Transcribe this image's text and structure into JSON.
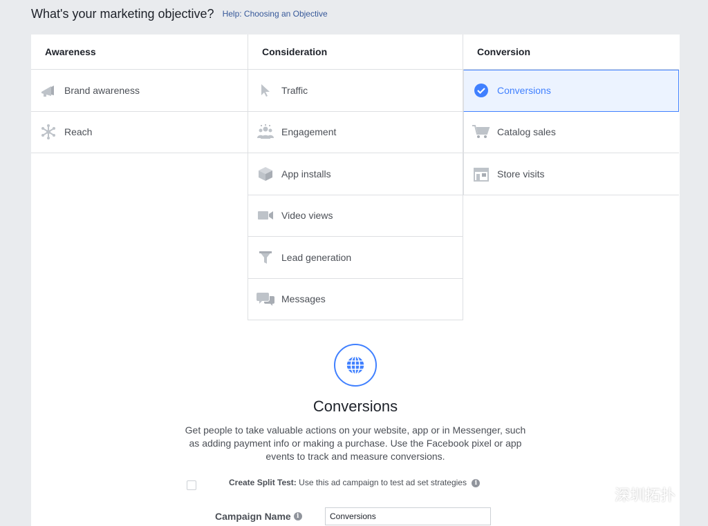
{
  "header": {
    "title": "What's your marketing objective?",
    "help_link": "Help: Choosing an Objective"
  },
  "columns": {
    "awareness": {
      "title": "Awareness",
      "items": [
        {
          "label": "Brand awareness",
          "icon": "megaphone-icon"
        },
        {
          "label": "Reach",
          "icon": "reach-icon"
        }
      ]
    },
    "consideration": {
      "title": "Consideration",
      "items": [
        {
          "label": "Traffic",
          "icon": "cursor-icon"
        },
        {
          "label": "Engagement",
          "icon": "people-icon"
        },
        {
          "label": "App installs",
          "icon": "box-icon"
        },
        {
          "label": "Video views",
          "icon": "video-camera-icon"
        },
        {
          "label": "Lead generation",
          "icon": "funnel-icon"
        },
        {
          "label": "Messages",
          "icon": "chat-bubbles-icon"
        }
      ]
    },
    "conversion": {
      "title": "Conversion",
      "items": [
        {
          "label": "Conversions",
          "icon": "check-circle-icon",
          "selected": true
        },
        {
          "label": "Catalog sales",
          "icon": "shopping-cart-icon"
        },
        {
          "label": "Store visits",
          "icon": "store-icon"
        }
      ]
    }
  },
  "detail": {
    "icon": "globe-icon",
    "title": "Conversions",
    "description": "Get people to take valuable actions on your website, app or in Messenger, such as adding payment info or making a purchase. Use the Facebook pixel or app events to track and measure conversions."
  },
  "split_test": {
    "label": "Create Split Test:",
    "description": "Use this ad campaign to test ad set strategies",
    "checked": false
  },
  "campaign_name": {
    "label": "Campaign Name",
    "value": "Conversions"
  },
  "watermark": {
    "text": "深圳拓扑"
  },
  "colors": {
    "accent": "#4080ff",
    "selected_bg": "#ecf3ff",
    "page_bg": "#e9ebee",
    "icon_gray": "#bec3c9"
  }
}
